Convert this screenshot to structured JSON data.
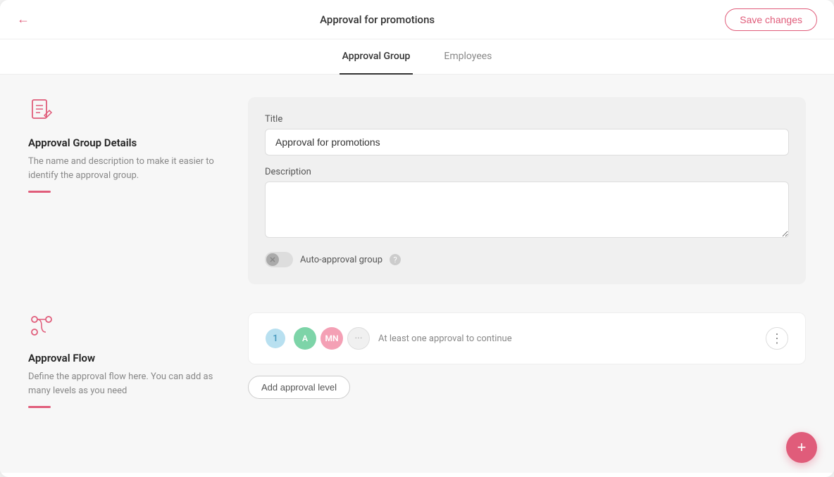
{
  "header": {
    "title": "Approval for promotions",
    "save_label": "Save changes",
    "back_icon": "←"
  },
  "tabs": [
    {
      "id": "approval-group",
      "label": "Approval Group",
      "active": true
    },
    {
      "id": "employees",
      "label": "Employees",
      "active": false
    }
  ],
  "approval_group_section": {
    "icon_label": "document-edit-icon",
    "title": "Approval Group Details",
    "description": "The name and description to make it easier to identify the approval group.",
    "form": {
      "title_label": "Title",
      "title_value": "Approval for promotions",
      "title_placeholder": "",
      "description_label": "Description",
      "description_value": "",
      "description_placeholder": "",
      "toggle_label": "Auto-approval group",
      "help_icon": "?"
    }
  },
  "approval_flow_section": {
    "icon_label": "flow-icon",
    "title": "Approval Flow",
    "description": "Define the approval flow here. You can add as many levels as you need",
    "flow_card": {
      "level": "1",
      "approvers": [
        {
          "initials": "A",
          "color": "green"
        },
        {
          "initials": "MN",
          "color": "pink"
        }
      ],
      "more_label": "···",
      "subtitle": "At least one approval to continue"
    },
    "add_button_label": "Add approval level"
  },
  "fab": {
    "icon": "+"
  }
}
